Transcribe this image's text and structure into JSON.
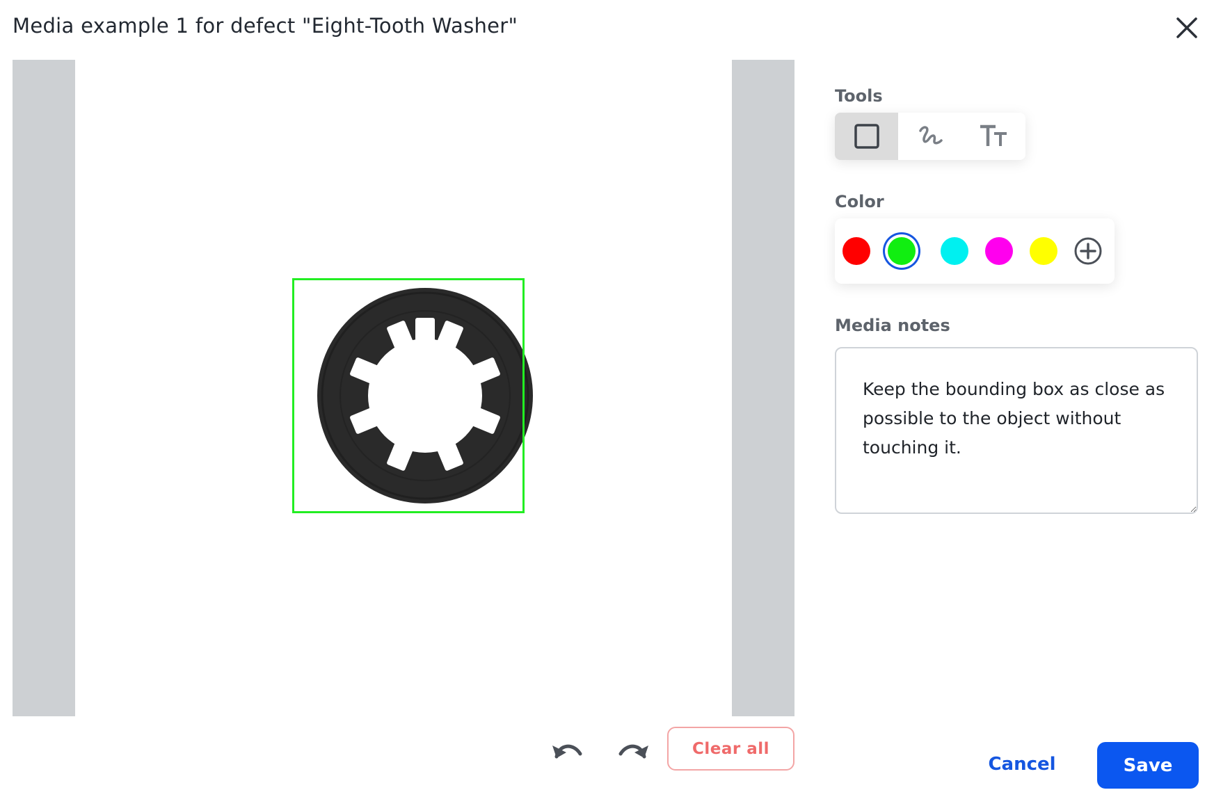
{
  "dialog": {
    "title": "Media example 1 for defect \"Eight-Tooth Washer\"",
    "close_icon": "close-icon"
  },
  "canvas": {
    "annotation_color": "#22ee22",
    "undo_icon": "undo-icon",
    "redo_icon": "redo-icon",
    "clear_all_label": "Clear all"
  },
  "tools": {
    "label": "Tools",
    "items": [
      {
        "name": "rectangle",
        "icon": "square-icon",
        "active": true
      },
      {
        "name": "freehand",
        "icon": "freehand-icon",
        "active": false
      },
      {
        "name": "text",
        "icon": "text-size-icon",
        "active": false
      }
    ]
  },
  "color": {
    "label": "Color",
    "swatches": [
      {
        "name": "red",
        "hex": "#ff0000",
        "selected": false
      },
      {
        "name": "green",
        "hex": "#11ee11",
        "selected": true
      },
      {
        "name": "cyan",
        "hex": "#00f0f0",
        "selected": false
      },
      {
        "name": "magenta",
        "hex": "#ff00ee",
        "selected": false
      },
      {
        "name": "yellow",
        "hex": "#ffff00",
        "selected": false
      }
    ],
    "add_icon": "plus-circle-icon",
    "selection_ring": "#1556e0"
  },
  "notes": {
    "label": "Media notes",
    "value": "Keep the bounding box as close as possible to the object without touching it."
  },
  "actions": {
    "cancel_label": "Cancel",
    "save_label": "Save",
    "primary_color": "#0b57f0"
  }
}
